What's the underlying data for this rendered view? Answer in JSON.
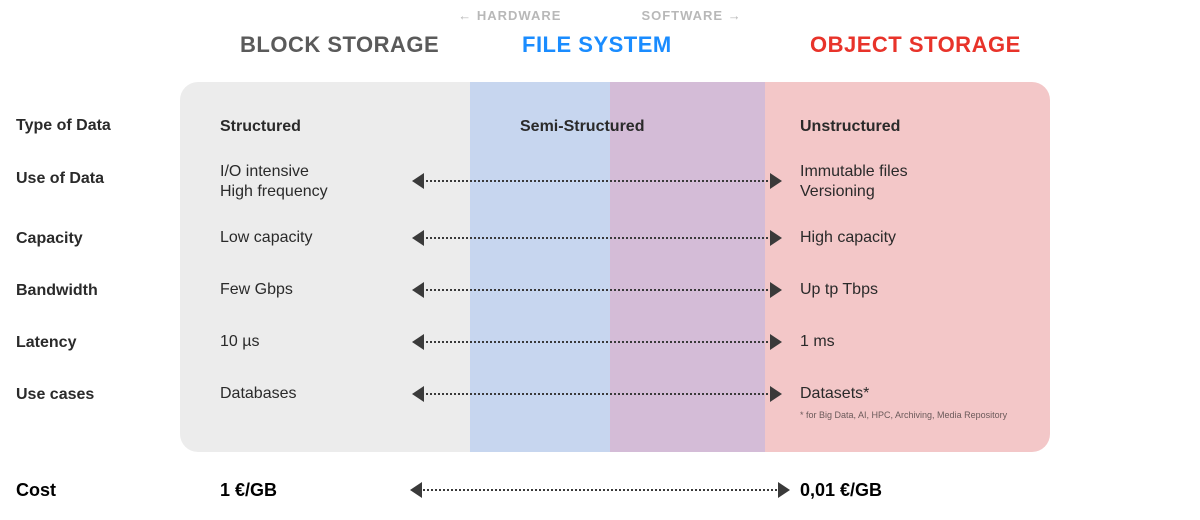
{
  "top": {
    "hardware": "HARDWARE",
    "software": "SOFTWARE"
  },
  "headers": {
    "block": "BLOCK STORAGE",
    "file": "FILE SYSTEM",
    "object": "OBJECT STORAGE"
  },
  "rows": {
    "labels": [
      "Type of Data",
      "Use of Data",
      "Capacity",
      "Bandwidth",
      "Latency",
      "Use cases"
    ],
    "type": {
      "left": "Structured",
      "mid": "Semi-Structured",
      "right": "Unstructured"
    },
    "use": {
      "left": "I/O intensive\nHigh frequency",
      "right": "Immutable files\nVersioning"
    },
    "capacity": {
      "left": "Low capacity",
      "right": "High capacity"
    },
    "bandwidth": {
      "left": "Few Gbps",
      "right": "Up tp Tbps"
    },
    "latency": {
      "left": "10 µs",
      "right": "1 ms"
    },
    "cases": {
      "left": "Databases",
      "right": "Datasets*"
    },
    "footnote": "* for Big Data, AI, HPC, Archiving, Media Repository"
  },
  "cost": {
    "label": "Cost",
    "left": "1 €/GB",
    "right": "0,01 €/GB"
  }
}
